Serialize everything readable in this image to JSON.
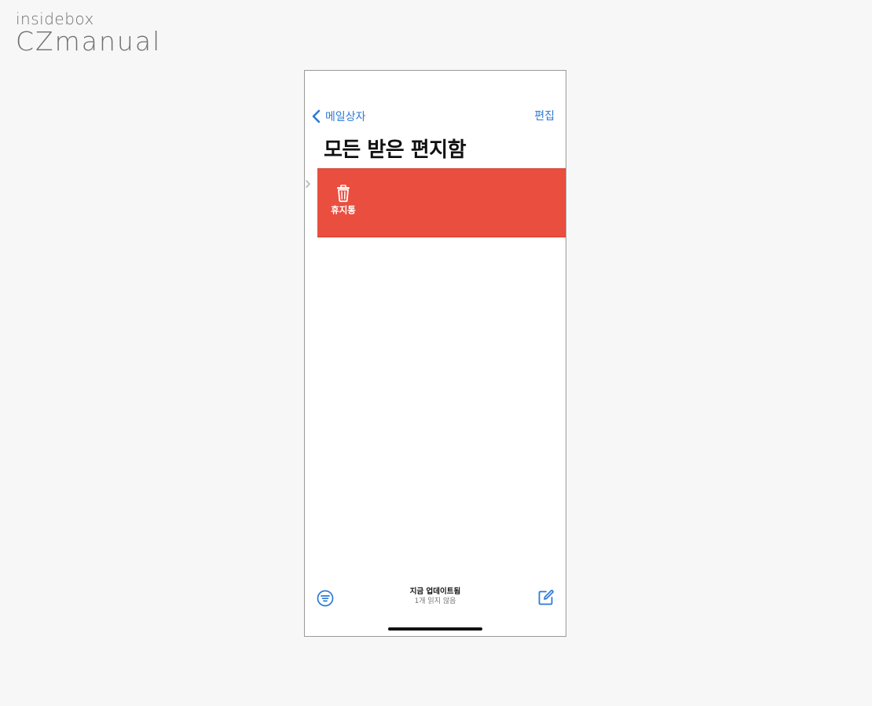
{
  "watermark": {
    "line1": "insidebox",
    "line2": "CZmanual"
  },
  "nav": {
    "back_label": "메일상자",
    "edit_label": "편집"
  },
  "title": "모든 받은 편지함",
  "swipe_action": {
    "label": "휴지통",
    "icon": "trash-icon",
    "color": "#e94e3f"
  },
  "toolbar": {
    "filter_icon": "filter-icon",
    "status_main": "지금 업데이트됨",
    "status_sub": "1개 읽지 않음",
    "compose_icon": "compose-icon"
  },
  "colors": {
    "accent": "#2f7ad4",
    "destructive": "#e94e3f"
  }
}
